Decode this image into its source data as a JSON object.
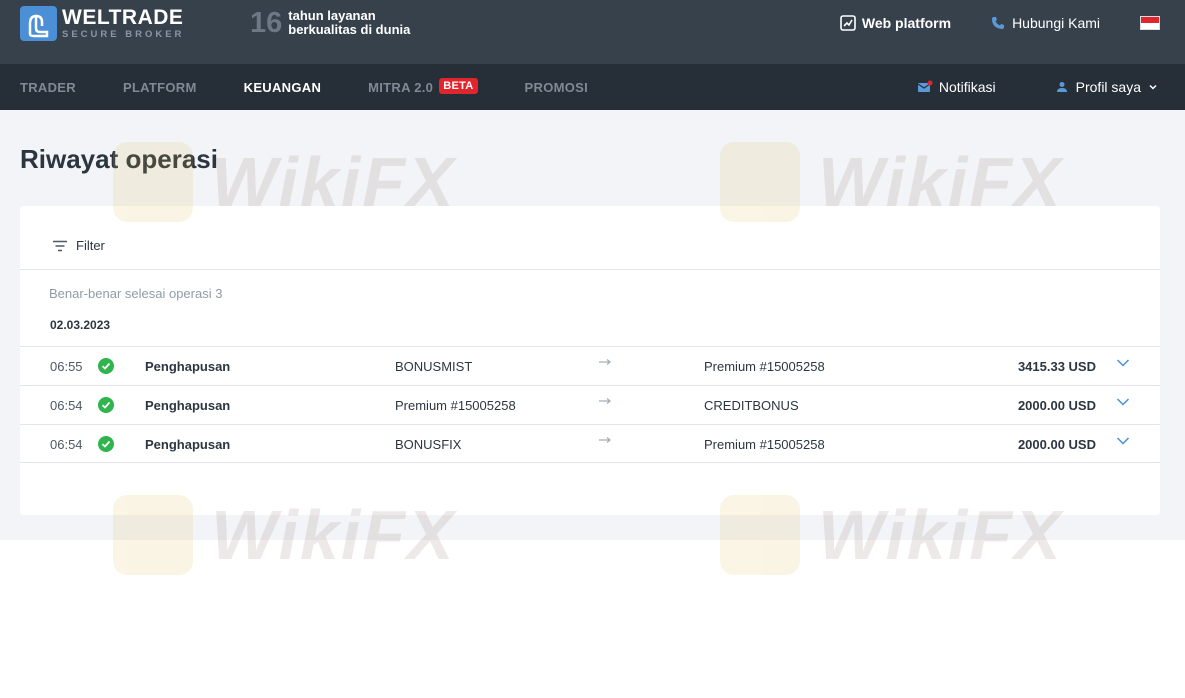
{
  "brand": {
    "name": "WELTRADE",
    "tagline": "SECURE BROKER",
    "years_number": "16",
    "years_line1": "tahun layanan",
    "years_line2": "berkualitas di dunia"
  },
  "topbar": {
    "web_platform": "Web platform",
    "contact": "Hubungi Kami",
    "flag_icon": "indonesia-flag-icon"
  },
  "nav": {
    "items": [
      {
        "label": "TRADER"
      },
      {
        "label": "PLATFORM"
      },
      {
        "label": "KEUANGAN",
        "active": true
      },
      {
        "label": "MITRA 2.0",
        "badge": "BETA"
      },
      {
        "label": "PROMOSI"
      }
    ],
    "notifications": "Notifikasi",
    "profile": "Profil saya"
  },
  "page": {
    "title": "Riwayat operasi",
    "filter_label": "Filter",
    "summary": "Benar-benar selesai operasi 3",
    "date": "02.03.2023"
  },
  "operations": [
    {
      "time": "06:55",
      "type": "Penghapusan",
      "from": "BONUSMIST",
      "to": "Premium #15005258",
      "amount": "3415.33 USD"
    },
    {
      "time": "06:54",
      "type": "Penghapusan",
      "from": "Premium #15005258",
      "to": "CREDITBONUS",
      "amount": "2000.00 USD"
    },
    {
      "time": "06:54",
      "type": "Penghapusan",
      "from": "BONUSFIX",
      "to": "Premium #15005258",
      "amount": "2000.00 USD"
    }
  ],
  "colors": {
    "topbar": "#37414c",
    "navbar": "#262f38",
    "accent": "#4b8fd6",
    "success": "#2fb44e",
    "beta": "#e0262c"
  },
  "watermark": "WikiFX"
}
